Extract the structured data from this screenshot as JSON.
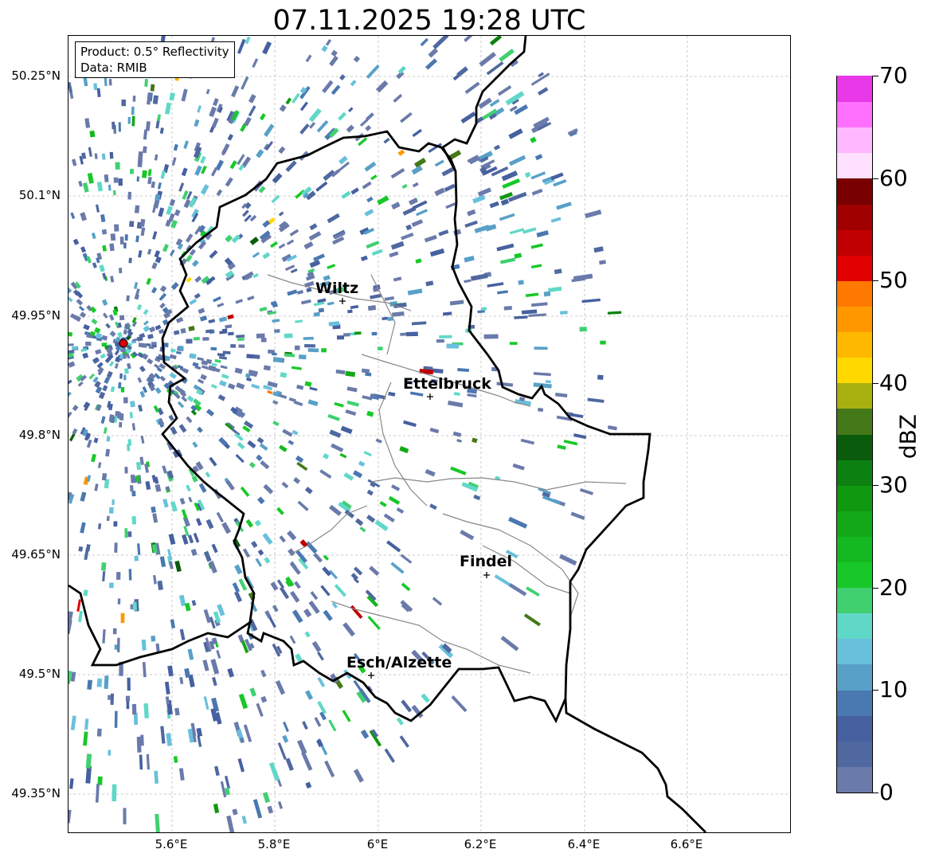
{
  "title": "07.11.2025 19:28 UTC",
  "info": {
    "product": "Product: 0.5° Reflectivity",
    "data": "Data: RMIB"
  },
  "axes": {
    "x_ticks": [
      "5.6°E",
      "5.8°E",
      "6°E",
      "6.2°E",
      "6.4°E",
      "6.6°E"
    ],
    "y_ticks": [
      "50.25°N",
      "50.1°N",
      "49.95°N",
      "49.8°N",
      "49.65°N",
      "49.5°N",
      "49.35°N"
    ]
  },
  "colorbar": {
    "label": "dBZ",
    "ticks": [
      "0",
      "10",
      "20",
      "30",
      "40",
      "50",
      "60",
      "70"
    ],
    "colors": [
      "#6a7aaa",
      "#5068a0",
      "#4660a0",
      "#4a78b0",
      "#58a0c8",
      "#68c0dc",
      "#60d8c8",
      "#40d070",
      "#18c828",
      "#14b820",
      "#12a818",
      "#109810",
      "#0c8010",
      "#0a5c0c",
      "#447818",
      "#a8b010",
      "#ffd800",
      "#ffb800",
      "#ff9800",
      "#ff7800",
      "#e00000",
      "#c00000",
      "#a00000",
      "#780000",
      "#ffe0ff",
      "#ffb8ff",
      "#ff70ff",
      "#e838e8"
    ]
  },
  "cities": [
    {
      "name": "Wiltz"
    },
    {
      "name": "Ettelbruck"
    },
    {
      "name": "Findel"
    },
    {
      "name": "Esch/Alzette"
    }
  ]
}
